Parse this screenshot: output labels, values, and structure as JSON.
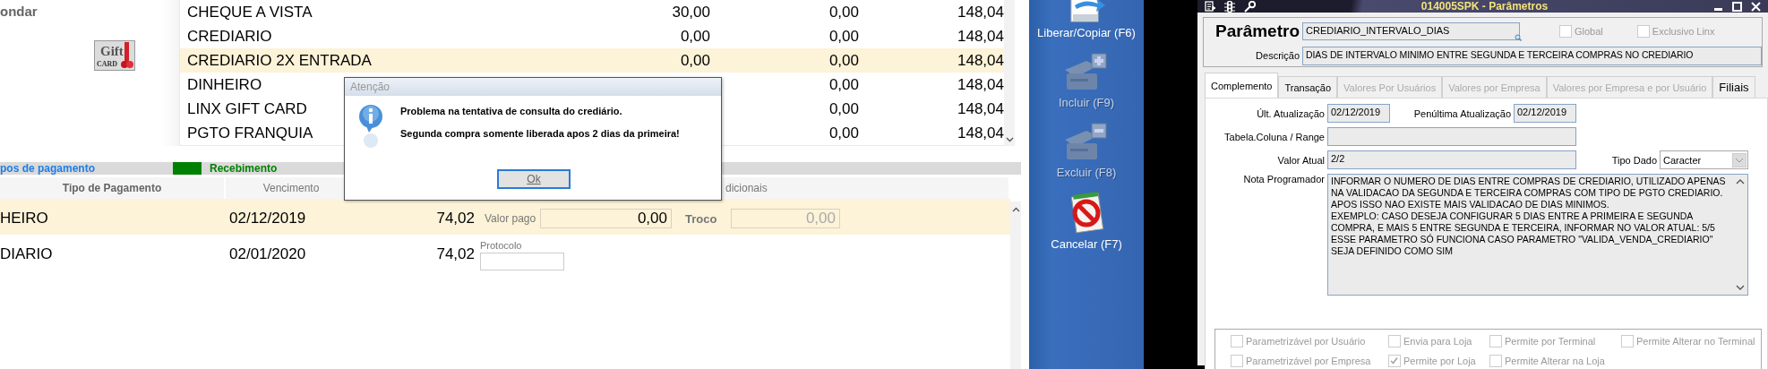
{
  "left_panel": {
    "label": "ondar",
    "gift_button": {
      "label": "Gift",
      "sublabel": "CARD"
    }
  },
  "payment_options": [
    {
      "name": "CHEQUE A VISTA",
      "col_2": "30,00",
      "col_3": "0,00",
      "col_4": "148,04",
      "selected": false
    },
    {
      "name": "CREDIARIO",
      "col_2": "0,00",
      "col_3": "0,00",
      "col_4": "148,04",
      "selected": false
    },
    {
      "name": "CREDIARIO 2X ENTRADA",
      "col_2": "0,00",
      "col_3": "0,00",
      "col_4": "148,04",
      "selected": true
    },
    {
      "name": "DINHEIRO",
      "col_3": "0,00",
      "col_4": "148,04",
      "selected": false
    },
    {
      "name": "LINX GIFT CARD",
      "col_3": "0,00",
      "col_4": "148,04",
      "selected": false
    },
    {
      "name": "PGTO FRANQUIA",
      "col_3": "0,00",
      "col_4": "148,04",
      "selected": false
    }
  ],
  "payments_bar": {
    "tab_label": "pos de pagamento",
    "legend": {
      "label": "Recebimento",
      "color": "#008000"
    }
  },
  "payments_table": {
    "columns": [
      "Tipo de Pagamento",
      "Vencimento",
      "dicionais"
    ],
    "rows": [
      {
        "kind": "payment",
        "type": "HEIRO",
        "due": "02/12/2019",
        "amount": "74,02",
        "selected": true,
        "paid_label": "Valor pago",
        "paid_value": "0,00",
        "change_label": "Troco",
        "change_value": "0,00"
      },
      {
        "kind": "protocol",
        "type": "DIARIO",
        "due": "02/01/2020",
        "amount": "74,02",
        "selected": false,
        "protocol_label": "Protocolo"
      }
    ]
  },
  "dialog": {
    "title": "Atenção",
    "messages": [
      "Problema na tentativa de consulta do crediário.",
      "Segunda compra somente liberada apos 2 dias da primeira!"
    ],
    "ok_button": "Ok"
  },
  "toolbar": [
    {
      "kind": "copy",
      "label": "Liberar/Copiar (F6)",
      "disabled": false
    },
    {
      "kind": "add",
      "label": "Incluir (F9)",
      "disabled": true
    },
    {
      "kind": "remove",
      "label": "Excluir (F8)",
      "disabled": true
    },
    {
      "kind": "cancel",
      "label": "Cancelar (F7)",
      "disabled": false
    }
  ],
  "window": {
    "title": "014005SPK - Parâmetros",
    "parameter_label": "Parâmetro",
    "parameter_value": "CREDIARIO_INTERVALO_DIAS",
    "flags": [
      {
        "label": "Global",
        "checked": false
      },
      {
        "label": "Exclusivo Linx",
        "checked": false
      }
    ],
    "description_label": "Descrição",
    "description_value": "DIAS DE INTERVALO MINIMO ENTRE SEGUNDA E TERCEIRA COMPRAS NO CREDIARIO",
    "tabs": [
      {
        "label": "Complemento",
        "selected": true,
        "disabled": false
      },
      {
        "label": "Transação",
        "selected": false,
        "disabled": false
      },
      {
        "label": "Valores Por Usuários",
        "selected": false,
        "disabled": true
      },
      {
        "label": "Valores por Empresa",
        "selected": false,
        "disabled": true
      },
      {
        "label": "Valores por Empresa e por Usuário",
        "selected": false,
        "disabled": true
      },
      {
        "label": "Filiais",
        "selected": false,
        "disabled": false
      }
    ],
    "last_update_label": "Últ. Atualização",
    "last_update": "02/12/2019",
    "previous_update_label": "Penúltima Atualização",
    "previous_update": "02/12/2019",
    "table_column_label": "Tabela.Coluna / Range",
    "current_value_label": "Valor Atual",
    "current_value": "2/2",
    "data_type_label": "Tipo Dado",
    "data_type": "Caracter",
    "note_label": "Nota Programador",
    "note": [
      "INFORMAR O NUMERO DE DIAS ENTRE COMPRAS DE CREDIARIO, UTILIZADO APENAS NA VALIDACAO DA SEGUNDA E TERCEIRA COMPRAS COM TIPO DE PGTO CREDIARIO.",
      "APOS ISSO NAO EXISTE MAIS VALIDACAO DE DIAS MINIMOS.",
      "EXEMPLO: CASO DESEJA CONFIGURAR 5 DIAS ENTRE A PRIMEIRA E SEGUNDA COMPRA, E MAIS 5 ENTRE SEGUNDA E TERCEIRA, INFORMAR NO VALOR ATUAL: 5/5",
      "ESSE PARAMETRO SÓ FUNCIONA CASO PARAMETRO \"VALIDA_VENDA_CREDIARIO\" SEJA DEFINIDO COMO SIM"
    ],
    "options": [
      {
        "label": "Parametrizável por Usuário",
        "checked": false
      },
      {
        "label": "Envia para Loja",
        "checked": false
      },
      {
        "label": "Permite por Terminal",
        "checked": false
      },
      {
        "label": "Permite Alterar no Terminal",
        "checked": false
      },
      {
        "label": "Parametrizável por Empresa",
        "checked": false
      },
      {
        "label": "Permite por Loja",
        "checked": true
      },
      {
        "label": "Permite Alterar na Loja",
        "checked": false
      }
    ]
  }
}
